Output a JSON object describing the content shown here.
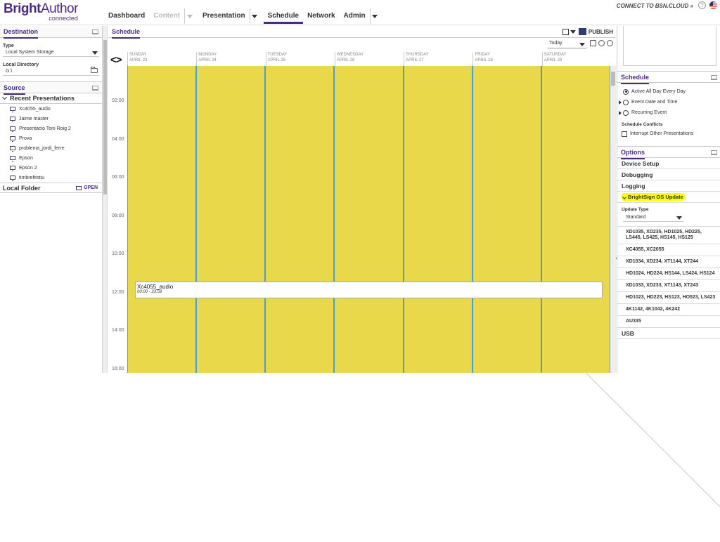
{
  "app": {
    "logo_bold": "Bright",
    "logo_rest": "Author",
    "logo_sub": "connected",
    "connect_label": "CONNECT TO BSN.CLOUD »"
  },
  "nav": [
    {
      "label": "Dashboard"
    },
    {
      "label": "Content"
    },
    {
      "label": "Presentation"
    },
    {
      "label": "Schedule"
    },
    {
      "label": "Network"
    },
    {
      "label": "Admin"
    }
  ],
  "left": {
    "destination_title": "Destination",
    "type_label": "Type",
    "type_value": "Local System Storage",
    "dir_label": "Local Directory",
    "dir_value": "G:\\",
    "source_title": "Source",
    "recent_title": "Recent Presentations",
    "recent": [
      "Xc4055_audio",
      "Jaime master",
      "Presentacio Toni Roig 2",
      "Prova",
      "problema_jordi_ferre",
      "Epson",
      "Epson 2",
      "timbrefestiu"
    ],
    "local_folder": "Local Folder",
    "open_label": "OPEN"
  },
  "center": {
    "title": "Schedule",
    "publish_label": "PUBLISH",
    "today_label": "Today",
    "days": [
      {
        "name": "SUNDAY",
        "date": "APRIL 23"
      },
      {
        "name": "MONDAY",
        "date": "APRIL 24"
      },
      {
        "name": "TUESDAY",
        "date": "APRIL 25"
      },
      {
        "name": "WEDNESDAY",
        "date": "APRIL 26"
      },
      {
        "name": "THURSDAY",
        "date": "APRIL 27"
      },
      {
        "name": "FRIDAY",
        "date": "APRIL 28"
      },
      {
        "name": "SATURDAY",
        "date": "APRIL 29"
      }
    ],
    "times": [
      "02:00",
      "04:00",
      "06:00",
      "08:00",
      "10:00",
      "12:00",
      "14:00",
      "16:00"
    ],
    "event_name": "Xc4055_audio",
    "event_time": "00:00 - 23:59",
    "grid_color": "#e9d84a",
    "line_color": "#4a9fd4"
  },
  "right": {
    "schedule_title": "Schedule",
    "opt_all_day": "Active All Day Every Day",
    "opt_event": "Event Date and Time",
    "opt_recurring": "Recurring Event",
    "conflicts_label": "Schedule Conflicts",
    "interrupt_label": "Interrupt Other Presentations",
    "options_title": "Options",
    "device_setup": "Device Setup",
    "debugging": "Debugging",
    "logging": "Logging",
    "os_update": "BrightSign OS Update",
    "update_type_label": "Update Type",
    "update_type_value": "Standard",
    "models": [
      "XD1035, XD235, HD1025, HD225, LS445, LS425, HS145, HS125",
      "XC4055, XC2055",
      "XD1034, XD234, XT1144, XT244",
      "HD1024, HD224, HS144, LS424, HS124",
      "XD1033, XD233, XT1143, XT243",
      "HD1023, HD223, HS123, HO523, LS423",
      "4K1142, 4K1042, 4K242",
      "AU335"
    ],
    "usb": "USB"
  },
  "colors": {
    "brand": "#4b2a82",
    "highlight": "#ffff00"
  }
}
